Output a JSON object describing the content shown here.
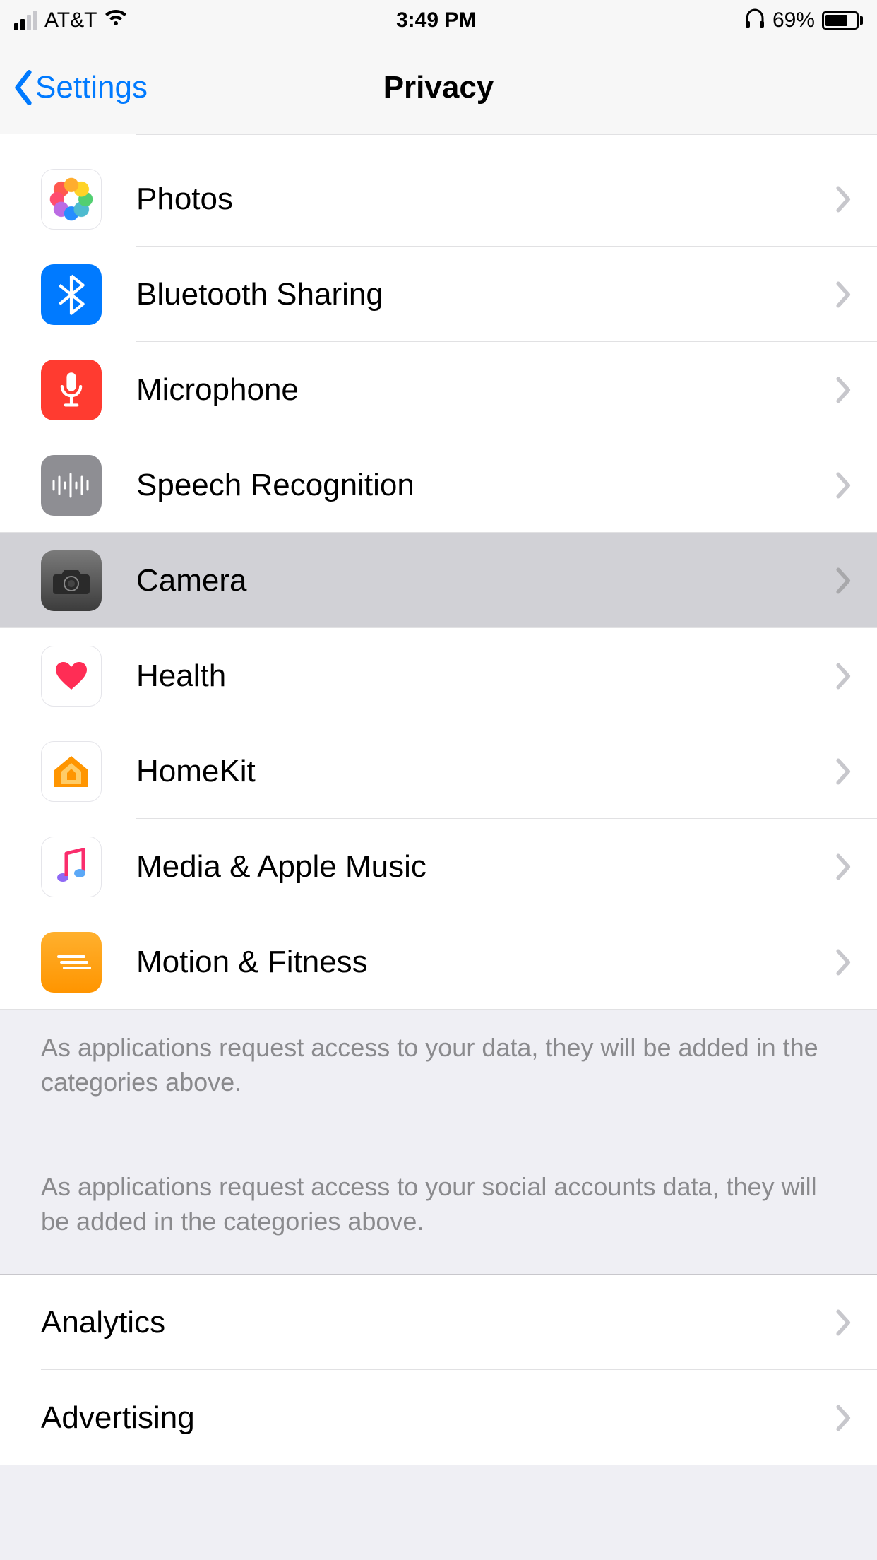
{
  "status": {
    "carrier": "AT&T",
    "time": "3:49 PM",
    "battery": "69%"
  },
  "nav": {
    "back": "Settings",
    "title": "Privacy"
  },
  "rows": {
    "photos": "Photos",
    "bluetooth": "Bluetooth Sharing",
    "microphone": "Microphone",
    "speech": "Speech Recognition",
    "camera": "Camera",
    "health": "Health",
    "homekit": "HomeKit",
    "media": "Media & Apple Music",
    "motion": "Motion & Fitness",
    "analytics": "Analytics",
    "advertising": "Advertising"
  },
  "footer": {
    "data": "As applications request access to your data, they will be added in the categories above.",
    "social": "As applications request access to your social accounts data, they will be added in the categories above."
  }
}
